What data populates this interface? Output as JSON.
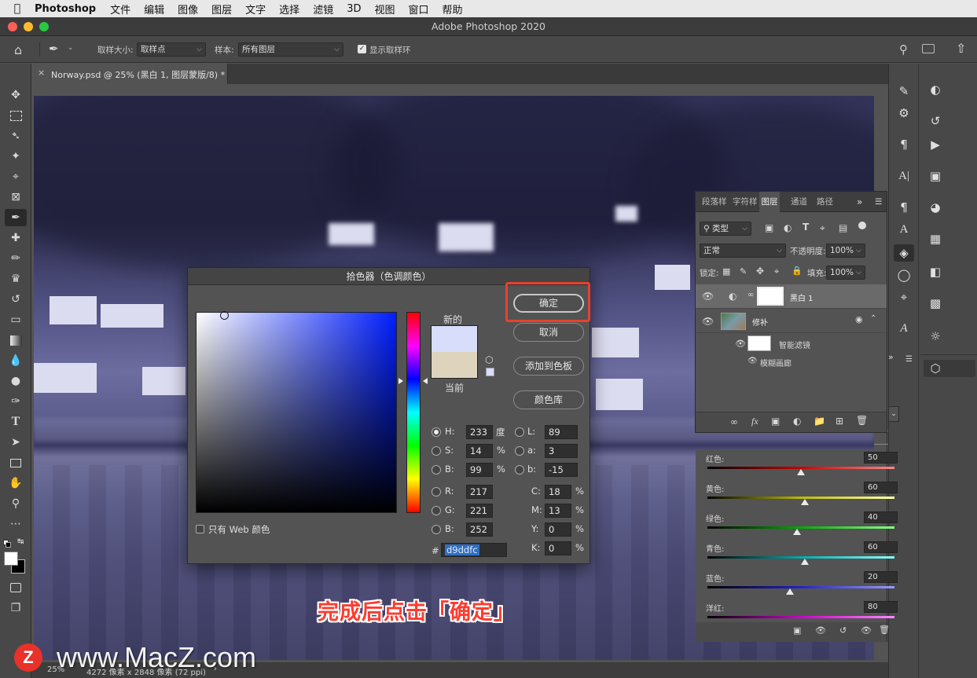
{
  "menubar": {
    "app": "Photoshop",
    "items": [
      "文件",
      "编辑",
      "图像",
      "图层",
      "文字",
      "选择",
      "滤镜",
      "3D",
      "视图",
      "窗口",
      "帮助"
    ]
  },
  "window": {
    "title": "Adobe Photoshop 2020"
  },
  "options_bar": {
    "sample_size_label": "取样大小:",
    "sample_size_value": "取样点",
    "sample_label": "样本:",
    "sample_value": "所有图层",
    "show_ring_label": "显示取样环"
  },
  "document_tab": {
    "label": "Norway.psd @ 25% (黑白 1, 图层蒙版/8) *"
  },
  "color_picker": {
    "title": "拾色器（色调颜色）",
    "ok_label": "确定",
    "cancel_label": "取消",
    "add_swatch_label": "添加到色板",
    "libraries_label": "颜色库",
    "new_label": "新的",
    "current_label": "当前",
    "new_color": "#d9ddfc",
    "current_color": "#ded3bd",
    "web_only_label": "只有 Web 颜色",
    "hsb": {
      "h": "233",
      "h_unit": "度",
      "s": "14",
      "s_unit": "%",
      "b": "99",
      "b_unit": "%"
    },
    "rgb": {
      "r": "217",
      "g": "221",
      "b": "252"
    },
    "lab": {
      "l": "89",
      "a": "3",
      "b": "-15"
    },
    "cmyk": {
      "c": "18",
      "m": "13",
      "y": "0",
      "k": "0"
    },
    "hex_label": "#",
    "hex": "d9ddfc",
    "labels": {
      "H": "H:",
      "S": "S:",
      "B": "B:",
      "R": "R:",
      "G": "G:",
      "Bb": "B:",
      "L": "L:",
      "a": "a:",
      "b": "b:",
      "C": "C:",
      "M": "M:",
      "Y": "Y:",
      "K": "K:",
      "pct": "%"
    }
  },
  "layers_panel": {
    "tabs": [
      "段落样",
      "字符样",
      "图层",
      "通道",
      "路径"
    ],
    "filter_label": "类型",
    "blend_mode": "正常",
    "opacity_label": "不透明度:",
    "opacity": "100%",
    "lock_label": "锁定:",
    "fill_label": "填充:",
    "fill": "100%",
    "layers": [
      {
        "name": "黑白 1"
      },
      {
        "name": "修补"
      },
      {
        "name": "智能滤镜"
      },
      {
        "name": "模糊画廊"
      }
    ]
  },
  "mixer_panel": {
    "sliders": [
      {
        "label": "红色:",
        "value": "50",
        "fraction": 0.5
      },
      {
        "label": "黄色:",
        "value": "60",
        "fraction": 0.52
      },
      {
        "label": "绿色:",
        "value": "40",
        "fraction": 0.48
      },
      {
        "label": "青色:",
        "value": "60",
        "fraction": 0.52
      },
      {
        "label": "蓝色:",
        "value": "20",
        "fraction": 0.44
      },
      {
        "label": "洋红:",
        "value": "80",
        "fraction": 0.56
      }
    ]
  },
  "status_bar": {
    "zoom": "25%",
    "doc_info": "4272 像素 x 2848 像素 (72 ppi)"
  },
  "caption": "完成后点击「确定」",
  "watermark": {
    "letter": "Z",
    "text": "www.MacZ.com"
  },
  "colors": {
    "highlight_box": "#e8412e",
    "hex_selection": "#2e6fc8"
  }
}
